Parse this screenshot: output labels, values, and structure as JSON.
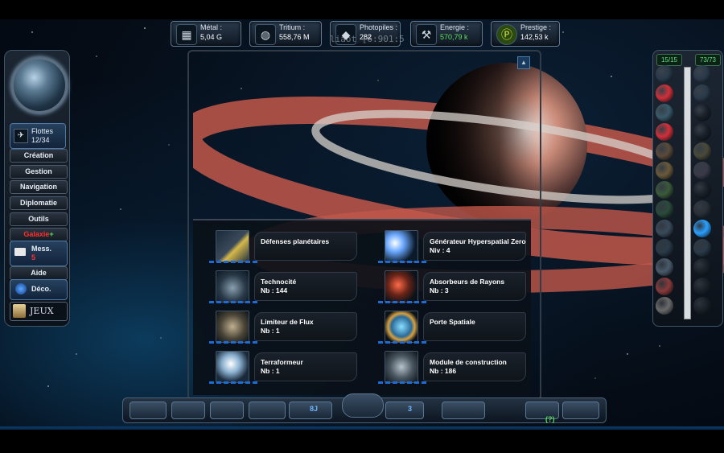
{
  "resources": [
    {
      "label": "Métal :",
      "value": "5,04 G",
      "icon": "metal-ingot-icon",
      "accent": "#ffffff"
    },
    {
      "label": "Tritium :",
      "value": "558,76 M",
      "icon": "tritium-flask-icon",
      "accent": "#ffffff"
    },
    {
      "label": "Photopiles :",
      "value": "282",
      "icon": "photopile-crystal-icon",
      "accent": "#ffffff"
    },
    {
      "label": "Energie :",
      "value": "570,79 k",
      "icon": "energy-wrench-icon",
      "accent": "#59e05a"
    },
    {
      "label": "Prestige :",
      "value": "142,53 k",
      "icon": "prestige-coin-icon",
      "accent": "#ffffff"
    }
  ],
  "coord_overlay": "liaot [6:901:5",
  "left_menu": {
    "fleets_label": "Flottes",
    "fleets_value": "12/34",
    "items": [
      "Création",
      "Gestion",
      "Navigation",
      "Diplomatie",
      "Outils",
      "Galaxie"
    ],
    "messages_label": "Mess.",
    "messages_count": "5",
    "help_label": "Aide",
    "logout_label": "Déco.",
    "games_label": "JEUX"
  },
  "grid_items": [
    {
      "name": "Défenses planétaires",
      "count": ""
    },
    {
      "name": "Générateur Hyperspatial Zero",
      "count": "Niv : 4"
    },
    {
      "name": "Technocité",
      "count": "Nb : 144"
    },
    {
      "name": "Absorbeurs de Rayons",
      "count": "Nb : 3"
    },
    {
      "name": "Limiteur de Flux",
      "count": "Nb : 1"
    },
    {
      "name": "Porte Spatiale",
      "count": ""
    },
    {
      "name": "Terraformeur",
      "count": "Nb : 1"
    },
    {
      "name": "Module de construction",
      "count": "Nb : 186"
    }
  ],
  "right_panel": {
    "tab_left": "15/15",
    "tab_right": "73/73"
  },
  "bottom_bar": {
    "count_a": "8J",
    "count_b": "3",
    "help_label": "(?)"
  },
  "colors": {
    "accent_blue": "#1e6bd6",
    "green": "#59e05a",
    "red": "#ff3030"
  }
}
